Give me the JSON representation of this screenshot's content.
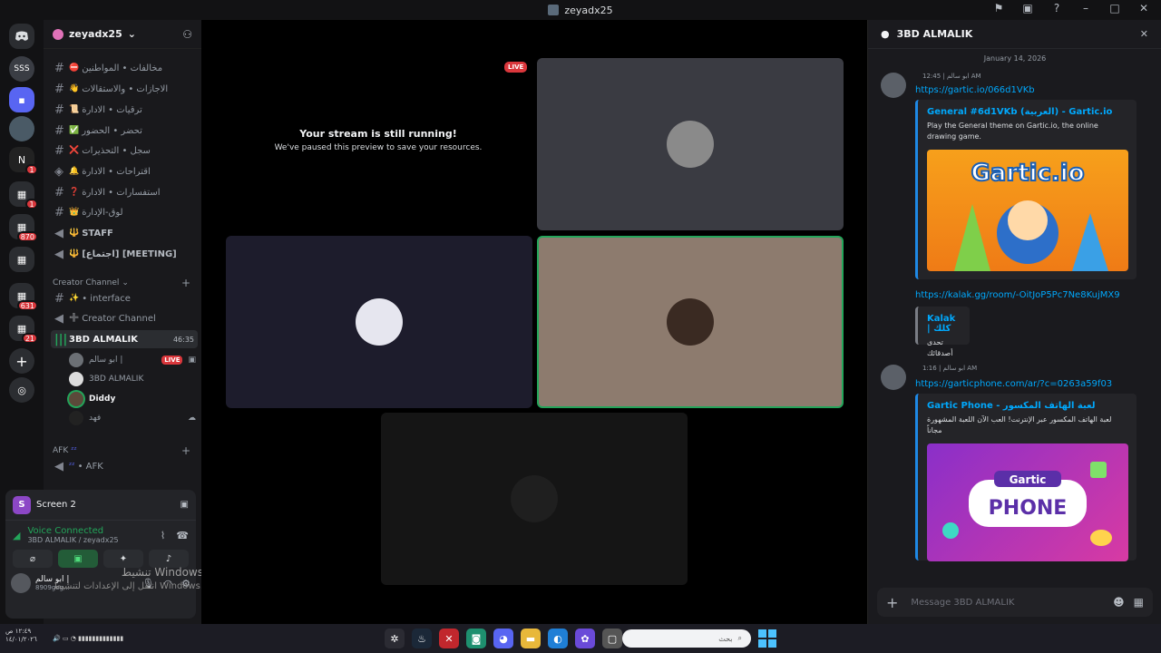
{
  "window": {
    "title": "zeyadx25"
  },
  "server": {
    "name": "zeyadx25",
    "rail_badges": [
      "1",
      "1",
      "870",
      "631",
      "21"
    ],
    "rail_label_1": "SSS"
  },
  "channels": [
    {
      "emoji": "⛔",
      "label": "مخالفات • المواطنين"
    },
    {
      "emoji": "👋",
      "label": "الاجازات • والاستقالات"
    },
    {
      "emoji": "📜",
      "label": "ترقيات • الادارة"
    },
    {
      "emoji": "✅",
      "label": "تحضر • الحضور"
    },
    {
      "emoji": "❌",
      "label": "سجل • التحذيرات"
    },
    {
      "emoji": "🔔",
      "label": "اقتراحات • الادارة"
    },
    {
      "emoji": "❓",
      "label": "استفسارات • الادارة"
    },
    {
      "emoji": "👑",
      "label": "لوق-الإدارة"
    },
    {
      "emoji": "🔱",
      "label": "STAFF"
    },
    {
      "emoji": "🔱",
      "label": "[اجتماع] [MEETING]"
    }
  ],
  "creator_category": "Creator Channel",
  "creator_channels": [
    {
      "emoji": "✨",
      "label": "• interface"
    },
    {
      "emoji": "➕",
      "label": "Creator Channel"
    }
  ],
  "active_voice": {
    "label": "3BD ALMALIK",
    "timer": "46:35"
  },
  "voice_users": [
    {
      "name": "ابو سالم |",
      "live": "LIVE"
    },
    {
      "name": "3BD ALMALIK"
    },
    {
      "name": "Diddy"
    },
    {
      "name": "فهد"
    }
  ],
  "afk_category": "AFK",
  "afk_channel": "• AFK",
  "voice_panel": {
    "screen_label": "Screen 2",
    "status": "Voice Connected",
    "location": "3BD ALMALIK / zeyadx25",
    "user_name": "ابو سالم |",
    "user_tag": "8909gog..."
  },
  "stage": {
    "live_label": "LIVE",
    "stream_title": "Your stream is still running!",
    "stream_sub": "We've paused this preview to save your resources."
  },
  "chat": {
    "title": "3BD ALMALIK",
    "date": "January 14, 2026",
    "msg1": {
      "author": "ابو سالم |",
      "time": "12:45 AM",
      "link": "https://gartic.io/066d1VKb",
      "embed_title": "General #6d1VKb (العربية) - Gartic.io",
      "embed_desc": "Play the General theme on Gartic.io, the online drawing game.",
      "image_text": "Gartic.io"
    },
    "msg2_link": "https://kalak.gg/room/-OitJoP5Pc7Ne8KujMX9",
    "embed2": {
      "title": "Kalak | كلك",
      "desc": "تحدى أصدقائك"
    },
    "msg3": {
      "author": "ابو سالم |",
      "time": "1:16 AM",
      "link": "https://garticphone.com/ar/?c=0263a59f03",
      "embed_title": "Gartic Phone - لعبة الهاتف المكسور",
      "embed_desc": "لعبة الهاتف المكسور عبر الإنترنت! العب الآن اللعبة المشهورة مجاناً",
      "image_text_1": "Gartic",
      "image_text_2": "PHONE"
    },
    "placeholder": "Message 3BD ALMALIK"
  },
  "watermark": {
    "line1": "تنشيط Windows",
    "line2": "انتقل إلى الإعدادات لتنشيط Windows."
  },
  "taskbar": {
    "clock_time": "١٢:٤٩ ص",
    "clock_date": "١٤/٠١/٢٠٢٦",
    "search_placeholder": "بحث"
  },
  "colors": {
    "accent": "#00a8fc",
    "live": "#da373c",
    "connected": "#23a55a"
  }
}
